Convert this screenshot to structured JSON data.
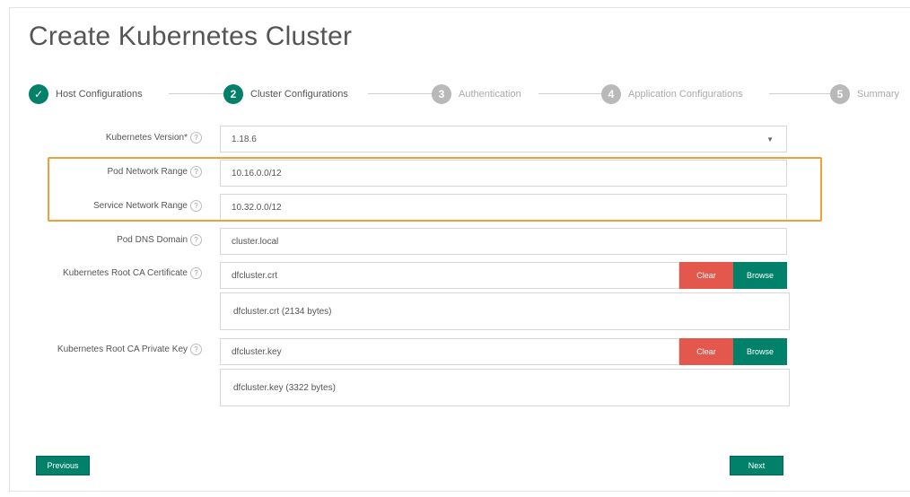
{
  "page": {
    "title": "Create Kubernetes Cluster"
  },
  "stepper": {
    "steps": [
      {
        "number": "✓",
        "label": "Host Configurations",
        "state": "done"
      },
      {
        "number": "2",
        "label": "Cluster Configurations",
        "state": "active"
      },
      {
        "number": "3",
        "label": "Authentication",
        "state": "pending"
      },
      {
        "number": "4",
        "label": "Application Configurations",
        "state": "pending"
      },
      {
        "number": "5",
        "label": "Summary",
        "state": "pending"
      }
    ]
  },
  "form": {
    "kubernetes_version": {
      "label": "Kubernetes Version*",
      "value": "1.18.6"
    },
    "pod_network_range": {
      "label": "Pod Network Range",
      "value": "10.16.0.0/12"
    },
    "service_network_range": {
      "label": "Service Network Range",
      "value": "10.32.0.0/12"
    },
    "pod_dns_domain": {
      "label": "Pod DNS Domain",
      "value": "cluster.local"
    },
    "root_ca_certificate": {
      "label": "Kubernetes Root CA Certificate",
      "value": "dfcluster.crt",
      "info": "dfcluster.crt (2134 bytes)"
    },
    "root_ca_private_key": {
      "label": "Kubernetes Root CA Private Key",
      "value": "dfcluster.key",
      "info": "dfcluster.key (3322 bytes)"
    },
    "clear_label": "Clear",
    "browse_label": "Browse",
    "help_glyph": "?"
  },
  "footer": {
    "previous_label": "Previous",
    "next_label": "Next"
  },
  "colors": {
    "accent": "#01806a",
    "danger": "#e3574c",
    "highlight": "#f0a038",
    "pending": "#b9b9b9"
  }
}
